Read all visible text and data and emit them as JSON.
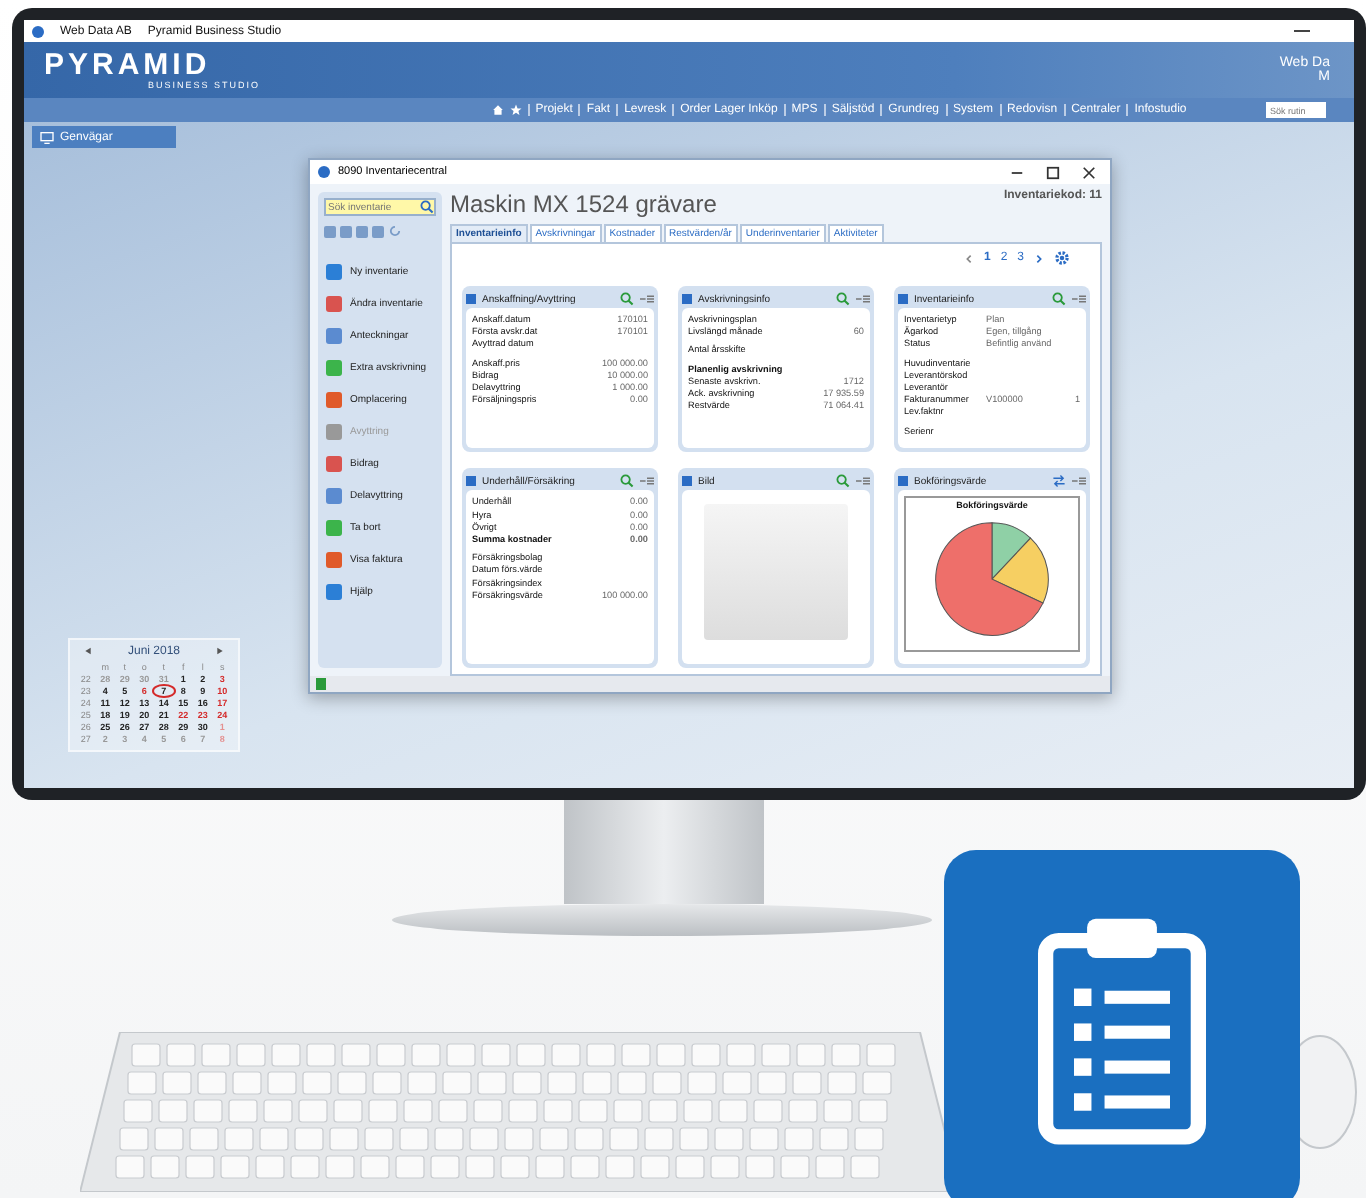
{
  "window": {
    "company": "Web Data AB",
    "title": "Pyramid Business Studio",
    "corner_name": "Web Da",
    "corner_sub": "M"
  },
  "logo": {
    "name": "PYRAMID",
    "tagline": "BUSINESS STUDIO"
  },
  "nav": [
    "Projekt",
    "Fakt",
    "Levresk",
    "Order Lager Inköp",
    "MPS",
    "Säljstöd",
    "Grundreg",
    "System",
    "Redovisn",
    "Centraler",
    "Infostudio"
  ],
  "routine_search": {
    "placeholder": "Sök rutin"
  },
  "shortcuts_tab": "Genvägar",
  "calendar": {
    "month": "Juni 2018",
    "weekdays": [
      "m",
      "t",
      "o",
      "t",
      "f",
      "l",
      "s"
    ],
    "weeks": [
      {
        "week": "22",
        "days": [
          {
            "d": "28",
            "kind": "other",
            "selected": false
          },
          {
            "d": "29",
            "kind": "other",
            "selected": false
          },
          {
            "d": "30",
            "kind": "other",
            "selected": false
          },
          {
            "d": "31",
            "kind": "other",
            "selected": false
          },
          {
            "d": "1",
            "kind": "day",
            "selected": false
          },
          {
            "d": "2",
            "kind": "day",
            "selected": false
          },
          {
            "d": "3",
            "kind": "holiday",
            "selected": false
          }
        ]
      },
      {
        "week": "23",
        "days": [
          {
            "d": "4",
            "kind": "day",
            "selected": false
          },
          {
            "d": "5",
            "kind": "day",
            "selected": false
          },
          {
            "d": "6",
            "kind": "holiday",
            "selected": false
          },
          {
            "d": "7",
            "kind": "day",
            "selected": true
          },
          {
            "d": "8",
            "kind": "day",
            "selected": false
          },
          {
            "d": "9",
            "kind": "day",
            "selected": false
          },
          {
            "d": "10",
            "kind": "holiday",
            "selected": false
          }
        ]
      },
      {
        "week": "24",
        "days": [
          {
            "d": "11",
            "kind": "day",
            "selected": false
          },
          {
            "d": "12",
            "kind": "day",
            "selected": false
          },
          {
            "d": "13",
            "kind": "day",
            "selected": false
          },
          {
            "d": "14",
            "kind": "day",
            "selected": false
          },
          {
            "d": "15",
            "kind": "day",
            "selected": false
          },
          {
            "d": "16",
            "kind": "day",
            "selected": false
          },
          {
            "d": "17",
            "kind": "holiday",
            "selected": false
          }
        ]
      },
      {
        "week": "25",
        "days": [
          {
            "d": "18",
            "kind": "day",
            "selected": false
          },
          {
            "d": "19",
            "kind": "day",
            "selected": false
          },
          {
            "d": "20",
            "kind": "day",
            "selected": false
          },
          {
            "d": "21",
            "kind": "day",
            "selected": false
          },
          {
            "d": "22",
            "kind": "holiday",
            "selected": false
          },
          {
            "d": "23",
            "kind": "holiday",
            "selected": false
          },
          {
            "d": "24",
            "kind": "holiday",
            "selected": false
          }
        ]
      },
      {
        "week": "26",
        "days": [
          {
            "d": "25",
            "kind": "day",
            "selected": false
          },
          {
            "d": "26",
            "kind": "day",
            "selected": false
          },
          {
            "d": "27",
            "kind": "day",
            "selected": false
          },
          {
            "d": "28",
            "kind": "day",
            "selected": false
          },
          {
            "d": "29",
            "kind": "day",
            "selected": false
          },
          {
            "d": "30",
            "kind": "day",
            "selected": false
          },
          {
            "d": "1",
            "kind": "otherholiday",
            "selected": false
          }
        ]
      },
      {
        "week": "27",
        "days": [
          {
            "d": "2",
            "kind": "other",
            "selected": false
          },
          {
            "d": "3",
            "kind": "other",
            "selected": false
          },
          {
            "d": "4",
            "kind": "other",
            "selected": false
          },
          {
            "d": "5",
            "kind": "other",
            "selected": false
          },
          {
            "d": "6",
            "kind": "other",
            "selected": false
          },
          {
            "d": "7",
            "kind": "other",
            "selected": false
          },
          {
            "d": "8",
            "kind": "otherholiday",
            "selected": false
          }
        ]
      }
    ]
  },
  "app_window": {
    "title": "8090 Inventariecentral",
    "search": {
      "placeholder": "Sök inventarie"
    },
    "actions": [
      {
        "label": "Ny inventarie",
        "disabled": false
      },
      {
        "label": "Ändra inventarie",
        "disabled": false
      },
      {
        "label": "Anteckningar",
        "disabled": false
      },
      {
        "label": "Extra avskrivning",
        "disabled": false
      },
      {
        "label": "Omplacering",
        "disabled": false
      },
      {
        "label": "Avyttring",
        "disabled": true
      },
      {
        "label": "Bidrag",
        "disabled": false
      },
      {
        "label": "Delavyttring",
        "disabled": false
      },
      {
        "label": "Ta bort",
        "disabled": false
      },
      {
        "label": "Visa faktura",
        "disabled": false
      },
      {
        "label": "Hjälp",
        "disabled": false
      }
    ],
    "heading": "Maskin MX 1524 grävare",
    "code": "Inventariekod: 11",
    "tabs": [
      {
        "label": "Inventarieinfo",
        "selected": true
      },
      {
        "label": "Avskrivningar",
        "selected": false
      },
      {
        "label": "Kostnader",
        "selected": false
      },
      {
        "label": "Restvärden/år",
        "selected": false
      },
      {
        "label": "Underinventarier",
        "selected": false
      },
      {
        "label": "Aktiviteter",
        "selected": false
      }
    ],
    "pages": [
      {
        "label": "1",
        "selected": true
      },
      {
        "label": "2",
        "selected": false
      },
      {
        "label": "3",
        "selected": false
      }
    ],
    "cards": [
      {
        "kind": "fields",
        "title": "Anskaffning/Avyttring",
        "rows": [
          {
            "kind": "row",
            "label": "Anskaff.datum",
            "values": [
              "170101"
            ]
          },
          {
            "kind": "row",
            "label": "Första avskr.dat",
            "values": [
              "170101"
            ]
          },
          {
            "kind": "row",
            "label": "Avyttrad datum"
          },
          {
            "kind": "group",
            "label": "Anskaff.pris",
            "values": [
              "100 000.00"
            ]
          },
          {
            "kind": "row",
            "label": "Bidrag",
            "values": [
              "10 000.00"
            ]
          },
          {
            "kind": "row",
            "label": "Delavyttring",
            "values": [
              "1 000.00"
            ]
          },
          {
            "kind": "row",
            "label": "Försäljningspris",
            "values": [
              "0.00"
            ]
          }
        ]
      },
      {
        "kind": "fields",
        "title": "Avskrivningsinfo",
        "rows": [
          {
            "kind": "row",
            "label": "Avskrivningsplan"
          },
          {
            "kind": "row",
            "label": "Livslängd månade",
            "values": [
              "60"
            ]
          },
          {
            "kind": "group",
            "label": "Antal årsskifte"
          },
          {
            "kind": "heading",
            "label": "Planenlig avskrivning"
          },
          {
            "kind": "row",
            "label": "Senaste avskrivn.",
            "values": [
              "1712"
            ]
          },
          {
            "kind": "row",
            "label": "Ack. avskrivning",
            "values": [
              "17 935.59"
            ]
          },
          {
            "kind": "row",
            "label": "Restvärde",
            "values": [
              "71 064.41"
            ]
          }
        ]
      },
      {
        "kind": "fields",
        "title": "Inventarieinfo",
        "rows": [
          {
            "kind": "row",
            "label": "Inventarietyp",
            "values": [
              "Plan"
            ]
          },
          {
            "kind": "row",
            "label": "Ägarkod",
            "values": [
              "Egen, tillgång"
            ]
          },
          {
            "kind": "row",
            "label": "Status",
            "values": [
              "Befintlig använd"
            ]
          },
          {
            "kind": "group",
            "label": "Huvudinventarie"
          },
          {
            "kind": "row",
            "label": "Leverantörskod"
          },
          {
            "kind": "row",
            "label": "Leverantör"
          },
          {
            "kind": "row",
            "label": "Fakturanummer",
            "values": [
              "V100000",
              "1"
            ]
          },
          {
            "kind": "row",
            "label": "Lev.faktnr"
          },
          {
            "kind": "group",
            "label": "Serienr"
          }
        ]
      },
      {
        "kind": "fields",
        "title": "Underhåll/Försäkring",
        "rows": [
          {
            "kind": "row",
            "label": "Underhåll",
            "values": [
              "0.00"
            ]
          },
          {
            "kind": "row",
            "label": "Hyra",
            "values": [
              "0.00"
            ]
          },
          {
            "kind": "row",
            "label": "Övrigt",
            "values": [
              "0.00"
            ]
          },
          {
            "kind": "total",
            "label": "Summa kostnader",
            "values": [
              "0.00"
            ]
          },
          {
            "kind": "group",
            "label": "Försäkringsbolag"
          },
          {
            "kind": "row",
            "label": "Datum förs.värde"
          },
          {
            "kind": "row",
            "label": "Försäkringsindex"
          },
          {
            "kind": "row",
            "label": "Försäkringsvärde",
            "values": [
              "100 000.00"
            ]
          }
        ]
      },
      {
        "kind": "photo",
        "title": "Bild"
      },
      {
        "kind": "pie",
        "title": "Bokföringsvärde",
        "chart_title": "Bokföringsvärde"
      }
    ]
  }
}
